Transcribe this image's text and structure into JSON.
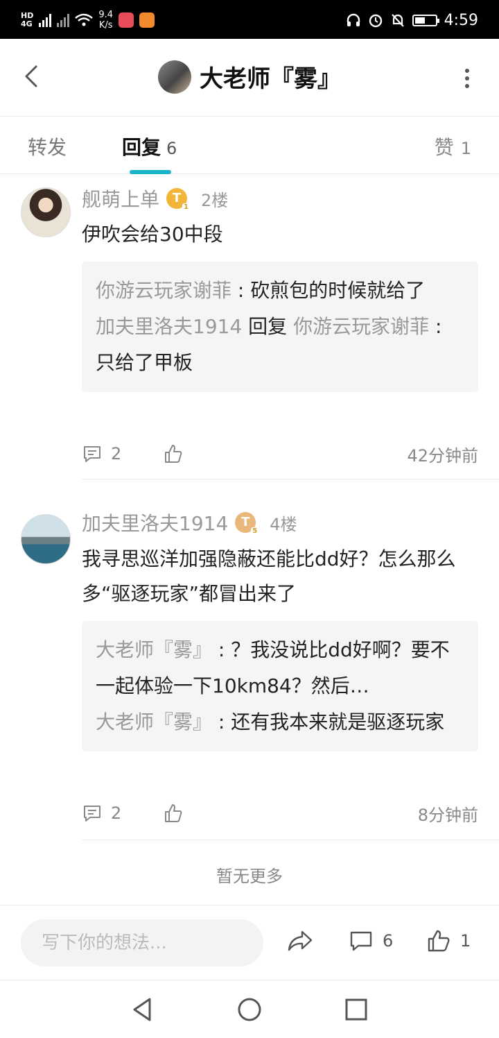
{
  "status_bar": {
    "network_label": "HD",
    "network_type": "4G",
    "speed_value": "9.4",
    "speed_unit": "K/s",
    "time": "4:59"
  },
  "header": {
    "title": "大老师『雾』"
  },
  "tabs": {
    "forward_label": "转发",
    "reply_label": "回复",
    "reply_count": "6",
    "like_label": "赞",
    "like_count": "1"
  },
  "comments": [
    {
      "user": "舰萌上单",
      "badge_level": "1",
      "floor": "2楼",
      "text": "伊吹会给30中段",
      "replies": [
        {
          "name": "你游云玩家谢菲",
          "separator": " : ",
          "text": "砍煎包的时候就给了"
        },
        {
          "name": "加夫里洛夫1914",
          "reply_word": " 回复 ",
          "target": "你游云玩家谢菲",
          "separator": " : ",
          "text": "只给了甲板"
        }
      ],
      "comment_count": "2",
      "time": "42分钟前"
    },
    {
      "user": "加夫里洛夫1914",
      "badge_level": "5",
      "floor": "4楼",
      "text": "我寻思巡洋加强隐蔽还能比dd好？怎么那么多“驱逐玩家”都冒出来了",
      "replies": [
        {
          "name": "大老师『雾』",
          "separator": " : ",
          "text": "？我没说比dd好啊？要不一起体验一下10km84？然后…"
        },
        {
          "name": "大老师『雾』",
          "separator": " : ",
          "text": "还有我本来就是驱逐玩家"
        }
      ],
      "comment_count": "2",
      "time": "8分钟前"
    }
  ],
  "no_more": "暂无更多",
  "bottom_bar": {
    "input_placeholder": "写下你的想法...",
    "comment_count": "6",
    "like_count": "1"
  },
  "icons": {
    "back": "chevron-left-icon",
    "more": "more-vertical-icon",
    "comment": "comment-icon",
    "like": "thumbs-up-icon",
    "share": "share-icon"
  },
  "colors": {
    "accent": "#19b4c8",
    "badge": "#f2b53a",
    "muted_text": "#999999"
  }
}
